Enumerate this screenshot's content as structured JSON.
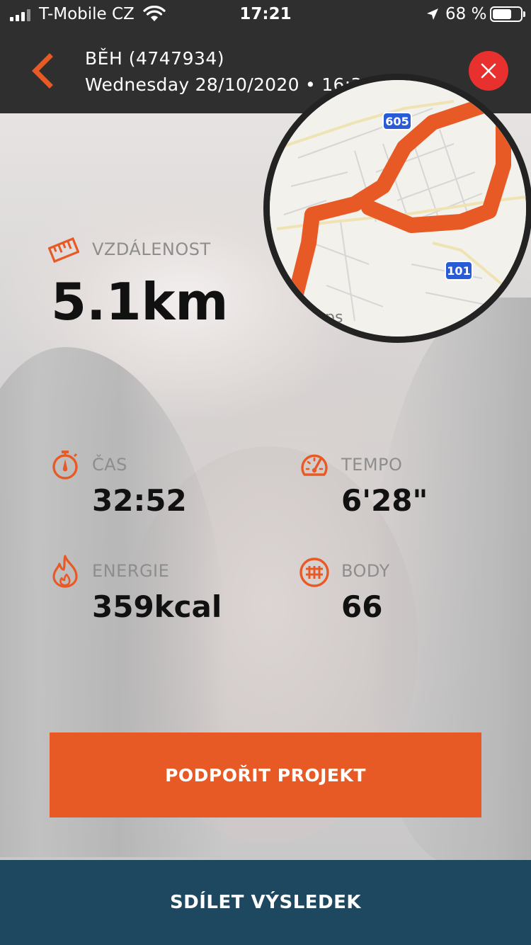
{
  "status_bar": {
    "carrier": "T-Mobile CZ",
    "time": "17:21",
    "battery_percent": "68 %",
    "battery_level": 0.68
  },
  "header": {
    "title": "BĚH (4747934)",
    "subtitle": "Wednesday 28/10/2020 • 16:33",
    "back_icon": "chevron-left-icon",
    "close_icon": "close-icon"
  },
  "map": {
    "road_labels": [
      "605",
      "101"
    ],
    "place_label": "ps"
  },
  "distance": {
    "label": "VZDÁLENOST",
    "value": "5.1km",
    "icon": "ruler-icon"
  },
  "stats": {
    "time": {
      "label": "ČAS",
      "value": "32:52",
      "icon": "stopwatch-icon"
    },
    "pace": {
      "label": "TEMPO",
      "value": "6'28\"",
      "icon": "speedometer-icon"
    },
    "energy": {
      "label": "ENERGIE",
      "value": "359kcal",
      "icon": "flame-icon"
    },
    "points": {
      "label": "BODY",
      "value": "66",
      "icon": "points-icon"
    }
  },
  "buttons": {
    "support": "PODPOŘIT PROJEKT",
    "share": "SDÍLET VÝSLEDEK"
  },
  "colors": {
    "accent": "#e85a25",
    "share_bg": "#1e4760",
    "header_bg": "#2f2f2f",
    "close_red": "#e8312e"
  }
}
